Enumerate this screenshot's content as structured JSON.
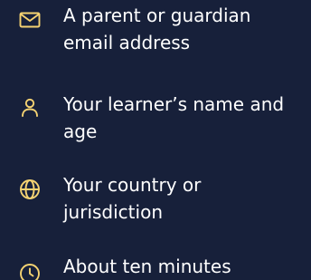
{
  "requirements": [
    {
      "icon": "envelope-icon",
      "text": "A parent or guardian email address"
    },
    {
      "icon": "person-icon",
      "text": "Your learner’s name and age"
    },
    {
      "icon": "globe-icon",
      "text": "Your country or jurisdiction"
    },
    {
      "icon": "clock-icon",
      "text": "About ten minutes"
    }
  ],
  "colors": {
    "background": "#17203a",
    "text": "#ffffff",
    "icon_accent": "#f6d372"
  }
}
